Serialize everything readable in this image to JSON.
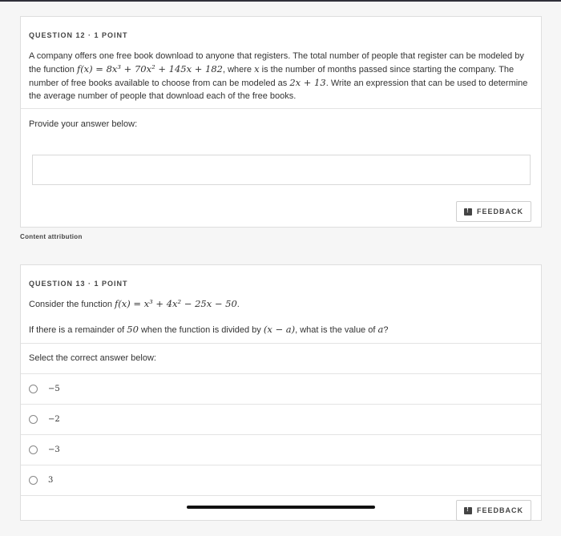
{
  "q12": {
    "header": "QUESTION 12 · 1 POINT",
    "text_a": "A company offers one free book download to anyone that registers. The total number of people that register can be modeled by the function ",
    "func": "f(x) = 8x³ + 70x² + 145x + 182",
    "text_b": ", where ",
    "var_x": "x",
    "text_c": " is the number of months passed since starting the company. The number of free books available to choose from can be modeled as ",
    "books_expr": "2x + 13",
    "text_d": ". Write an expression that can be used to determine the average number of people that download each of the free books.",
    "prompt": "Provide your answer below:",
    "answer_value": "",
    "feedback_label": "FEEDBACK"
  },
  "attribution": "Content attribution",
  "q13": {
    "header": "QUESTION 13 · 1 POINT",
    "text_a": "Consider the function ",
    "func": "f(x) = x³ + 4x² − 25x − 50",
    "text_b": ".",
    "line2_a": "If there is a remainder of ",
    "remainder": "50",
    "line2_b": " when the function is divided by ",
    "divisor": "(x − a)",
    "line2_c": ", what is the value of ",
    "var_a": "a",
    "line2_d": "?",
    "prompt": "Select the correct answer below:",
    "choices": [
      "−5",
      "−2",
      "−3",
      "3"
    ],
    "feedback_label": "FEEDBACK"
  },
  "icons": {
    "feedback": "feedback-icon",
    "radio": "radio-icon"
  }
}
